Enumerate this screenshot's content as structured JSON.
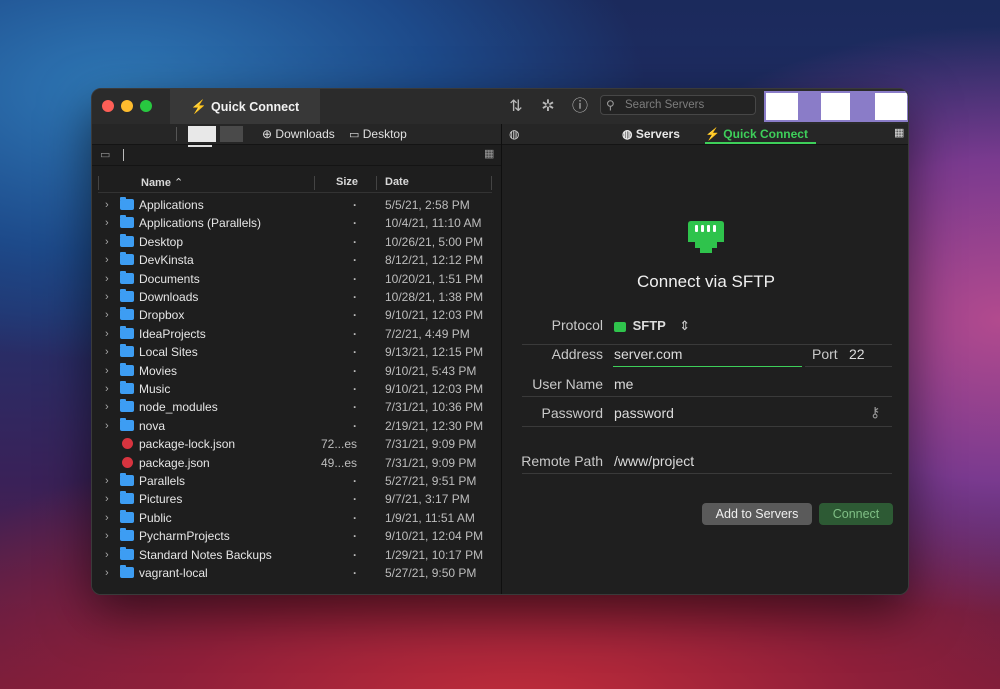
{
  "titlebar": {
    "active_tab": "Quick Connect",
    "search_placeholder": "Search Servers"
  },
  "left_pane": {
    "favorites": [
      "Downloads",
      "Desktop"
    ],
    "columns": [
      "Name",
      "Size",
      "Date"
    ],
    "rows": [
      {
        "name": "Applications",
        "size": "-",
        "date": "5/5/21, 2:58 PM",
        "kind": "folder"
      },
      {
        "name": "Applications (Parallels)",
        "size": "-",
        "date": "10/4/21, 11:10 AM",
        "kind": "folder"
      },
      {
        "name": "Desktop",
        "size": "-",
        "date": "10/26/21, 5:00 PM",
        "kind": "folder"
      },
      {
        "name": "DevKinsta",
        "size": "-",
        "date": "8/12/21, 12:12 PM",
        "kind": "folder"
      },
      {
        "name": "Documents",
        "size": "-",
        "date": "10/20/21, 1:51 PM",
        "kind": "folder"
      },
      {
        "name": "Downloads",
        "size": "-",
        "date": "10/28/21, 1:38 PM",
        "kind": "folder"
      },
      {
        "name": "Dropbox",
        "size": "-",
        "date": "9/10/21, 12:03 PM",
        "kind": "folder"
      },
      {
        "name": "IdeaProjects",
        "size": "-",
        "date": "7/2/21, 4:49 PM",
        "kind": "folder"
      },
      {
        "name": "Local Sites",
        "size": "-",
        "date": "9/13/21, 12:15 PM",
        "kind": "folder"
      },
      {
        "name": "Movies",
        "size": "-",
        "date": "9/10/21, 5:43 PM",
        "kind": "folder"
      },
      {
        "name": "Music",
        "size": "-",
        "date": "9/10/21, 12:03 PM",
        "kind": "folder"
      },
      {
        "name": "node_modules",
        "size": "-",
        "date": "7/31/21, 10:36 PM",
        "kind": "folder"
      },
      {
        "name": "nova",
        "size": "-",
        "date": "2/19/21, 12:30 PM",
        "kind": "folder"
      },
      {
        "name": "package-lock.json",
        "size": "72...es",
        "date": "7/31/21, 9:09 PM",
        "kind": "file"
      },
      {
        "name": "package.json",
        "size": "49...es",
        "date": "7/31/21, 9:09 PM",
        "kind": "file"
      },
      {
        "name": "Parallels",
        "size": "-",
        "date": "5/27/21, 9:51 PM",
        "kind": "folder"
      },
      {
        "name": "Pictures",
        "size": "-",
        "date": "9/7/21, 3:17 PM",
        "kind": "folder"
      },
      {
        "name": "Public",
        "size": "-",
        "date": "1/9/21, 11:51 AM",
        "kind": "folder"
      },
      {
        "name": "PycharmProjects",
        "size": "-",
        "date": "9/10/21, 12:04 PM",
        "kind": "folder"
      },
      {
        "name": "Standard Notes Backups",
        "size": "-",
        "date": "1/29/21, 10:17 PM",
        "kind": "folder"
      },
      {
        "name": "vagrant-local",
        "size": "-",
        "date": "5/27/21, 9:50 PM",
        "kind": "folder"
      }
    ]
  },
  "right_pane": {
    "tabs": {
      "servers": "Servers",
      "quick_connect": "Quick Connect"
    },
    "heading": "Connect via SFTP",
    "protocol_label": "Protocol",
    "protocol_value": "SFTP",
    "address_label": "Address",
    "address_value": "server.com",
    "port_label": "Port",
    "port_value": "22",
    "username_label": "User Name",
    "username_value": "me",
    "password_label": "Password",
    "password_value": "password",
    "remote_path_label": "Remote Path",
    "remote_path_value": "/www/project",
    "add_button": "Add to Servers",
    "connect_button": "Connect"
  },
  "colors": {
    "accent_green": "#3ecf5a",
    "window_bg": "#1e1e1e"
  }
}
